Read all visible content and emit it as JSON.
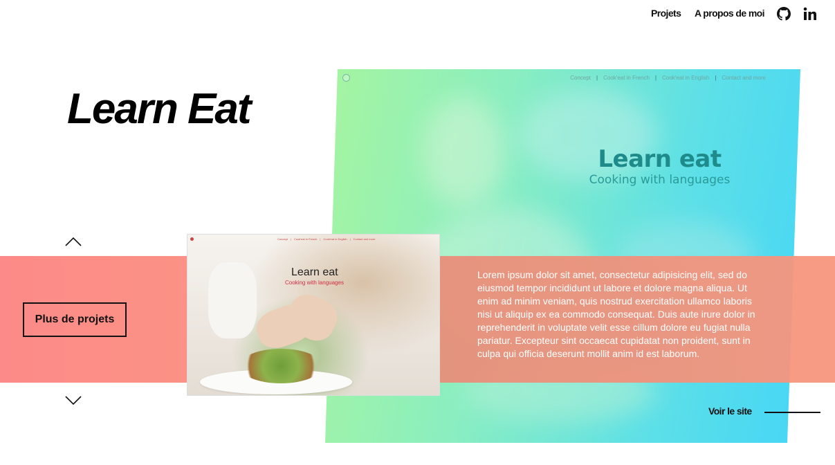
{
  "nav": {
    "projects_label": "Projets",
    "about_label": "A propos de moi",
    "icons": [
      "github-icon",
      "linkedin-icon"
    ]
  },
  "page": {
    "title": "Learn Eat"
  },
  "hero": {
    "mini_nav": [
      "Concept",
      "Cook'eat in French",
      "Cook'eat in English",
      "Contact and more"
    ],
    "title": "Learn eat",
    "subtitle": "Cooking with languages"
  },
  "thumbnail": {
    "mini_nav": [
      "Concept",
      "Cook'eat in French",
      "Cook'eat in English",
      "Contact and more"
    ],
    "title": "Learn eat",
    "subtitle": "Cooking with languages"
  },
  "project": {
    "description": "Lorem ipsum dolor sit amet, consectetur adipisicing elit, sed do eiusmod tempor incididunt ut labore et dolore magna aliqua. Ut enim ad minim veniam, quis nostrud exercitation ullamco laboris nisi ut aliquip ex ea commodo consequat. Duis aute irure dolor in reprehenderit in voluptate velit esse cillum dolore eu fugiat nulla pariatur. Excepteur sint occaecat cupidatat non proident, sunt in culpa qui officia deserunt mollit anim id est laborum.",
    "more_projects_label": "Plus de projets",
    "visit_label": "Voir le site"
  },
  "colors": {
    "band": "#fc8a88",
    "band_right": "#f8967e",
    "gradient_start": "#a6f5a0",
    "gradient_end": "#46d6f6",
    "hero_title": "#1f8a8a",
    "thumb_subtitle": "#d02c44"
  }
}
